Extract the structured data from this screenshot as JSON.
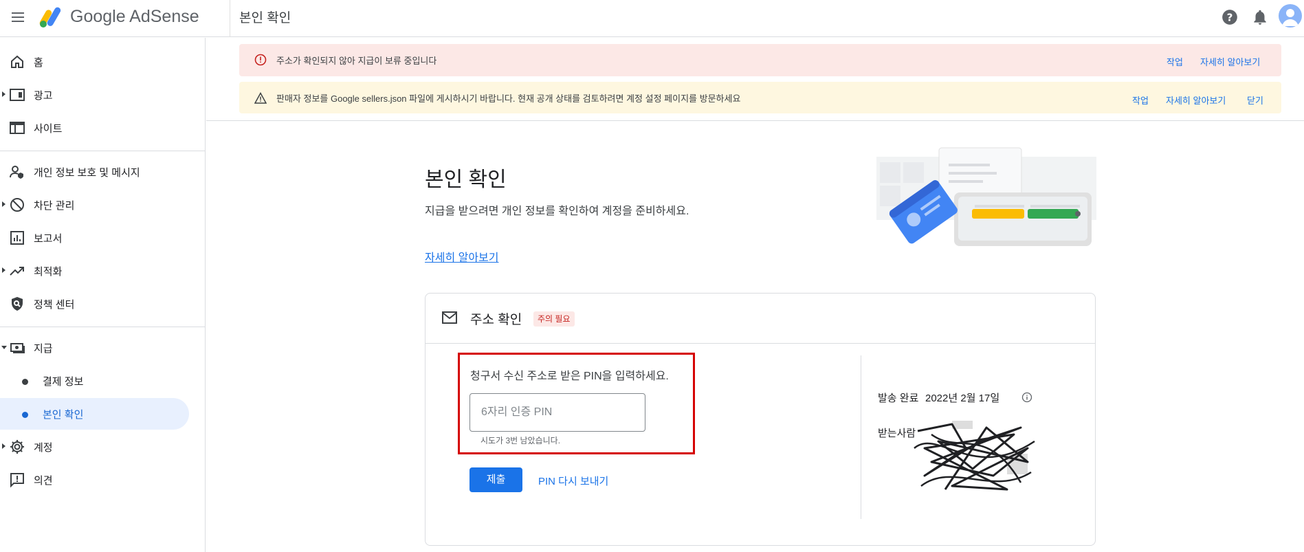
{
  "header": {
    "brand": "Google AdSense",
    "page_title": "본인 확인"
  },
  "sidebar": {
    "items": [
      {
        "label": "홈",
        "icon": "home-icon"
      },
      {
        "label": "광고",
        "icon": "ads-icon"
      },
      {
        "label": "사이트",
        "icon": "sites-icon"
      },
      {
        "label": "개인 정보 보호 및 메시지",
        "icon": "privacy-icon"
      },
      {
        "label": "차단 관리",
        "icon": "block-icon"
      },
      {
        "label": "보고서",
        "icon": "reports-icon"
      },
      {
        "label": "최적화",
        "icon": "optimization-icon"
      },
      {
        "label": "정책 센터",
        "icon": "policy-icon"
      },
      {
        "label": "지급",
        "icon": "payments-icon"
      },
      {
        "label": "결제 정보"
      },
      {
        "label": "본인 확인"
      },
      {
        "label": "계정",
        "icon": "gear-icon"
      },
      {
        "label": "의견",
        "icon": "feedback-icon"
      }
    ]
  },
  "banners": {
    "red": {
      "text": "주소가 확인되지 않아 지급이 보류 중입니다",
      "action": "작업",
      "learn": "자세히 알아보기"
    },
    "yellow": {
      "text": "판매자 정보를 Google sellers.json 파일에 게시하시기 바랍니다. 현재 공개 상태를 검토하려면 계정 설정 페이지를 방문하세요",
      "action": "작업",
      "learn": "자세히 알아보기",
      "close": "닫기"
    }
  },
  "main": {
    "title": "본인 확인",
    "description": "지급을 받으려면 개인 정보를 확인하여 계정을 준비하세요.",
    "learn_more": "자세히 알아보기"
  },
  "card": {
    "title": "주소 확인",
    "badge": "주의 필요",
    "pin_prompt": "청구서 수신 주소로 받은 PIN을 입력하세요.",
    "pin_placeholder": "6자리 인증 PIN",
    "attempts_left": "시도가 3번 남았습니다.",
    "submit": "제출",
    "resend": "PIN 다시 보내기",
    "sent_label": "발송 완료",
    "sent_date": "2022년 2월 17일",
    "recipient_label": "받는사람"
  },
  "colors": {
    "accent": "#1a73e8",
    "error_bg": "#fce8e6",
    "warning_bg": "#fef7e0",
    "highlight_border": "#d50000"
  }
}
